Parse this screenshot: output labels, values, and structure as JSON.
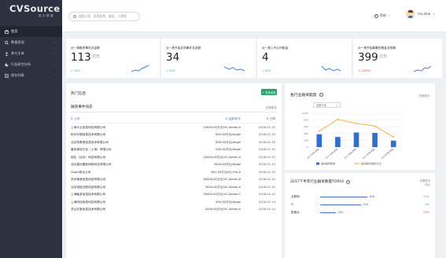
{
  "brand": {
    "logo": "CVSource",
    "sub": "投中数据"
  },
  "sidebar": {
    "items": [
      {
        "label": "首页",
        "active": true,
        "has_chevron": false,
        "icon": "home-icon"
      },
      {
        "label": "数据发现",
        "active": false,
        "has_chevron": true,
        "icon": "search-icon"
      },
      {
        "label": "参与主体",
        "active": false,
        "has_chevron": true,
        "icon": "people-icon"
      },
      {
        "label": "行业研究分析",
        "active": false,
        "has_chevron": true,
        "icon": "chart-icon"
      },
      {
        "label": "保存列表",
        "active": false,
        "has_chevron": true,
        "icon": "list-icon"
      }
    ]
  },
  "topbar": {
    "search_placeholder": "搜索公司、投资机构、基金、人物等",
    "help_label": "帮助",
    "help_chevron": "∨",
    "username": "ms.zhai",
    "user_chevron": "∨"
  },
  "stats": [
    {
      "label": "近一周融资事件总金额",
      "value": "113",
      "unit": "亿元",
      "change": "↓ 16%",
      "negative": false,
      "colors": "#3b7fd9"
    },
    {
      "label": "近一周开始并购事件总金额",
      "value": "34",
      "unit": "",
      "change": "↓ 40%",
      "negative": false
    },
    {
      "label": "近一周上市公司数量",
      "value": "4",
      "unit": "",
      "change": "↓ 60%",
      "negative": false
    },
    {
      "label": "近一周开始募集的基金总规模",
      "value": "399",
      "unit": "亿元",
      "change": "↑ 1229%",
      "negative": true
    }
  ],
  "hot": {
    "title": "热门信息",
    "publish_label": "+ 发布动态",
    "tab": "融资事件动态",
    "more": "查看更多",
    "columns": [
      "公司",
      "金额/轮次",
      "日期"
    ],
    "rows": [
      [
        "上海众云信息科技有限公司",
        "10000.00万元/VC-Series A",
        "2018.01.15"
      ],
      [
        "杭州乐期信息技术有限公司",
        "500.00万元/Angel",
        "2018.01.15"
      ],
      [
        "北京牧青美信息技术有限公司",
        "500.00万元/Angel",
        "2018.01.15"
      ],
      [
        "重庆美地文化（上海）有限公司",
        "200.00万元/Angel",
        "2018.01.15"
      ],
      [
        "和应（北京）科技有限公司",
        "10000.00万元/VC-Series A",
        "2018.01.15"
      ],
      [
        "北京星优耀信网络科技有限公司",
        "2000.00万元/Angel",
        "2018.01.15"
      ],
      [
        "Zoom购买公司",
        "651.00万元/VC-Pre-A",
        "2018.01.15"
      ],
      [
        "苏州美维信息科技有限公司",
        "40000.00万元/VC-Series B",
        "2018.01.15"
      ],
      [
        "北京锐能互联科技有限公司",
        "3000.00万元/VC-Series A",
        "2018.01.15"
      ],
      [
        "上海聚游信息技术有限公司",
        "30000.00万元/VC-Series C",
        "2018.01.15"
      ],
      [
        "上海听知信息科技有限公司",
        "300.00万元/Angel",
        "2018.01.14"
      ],
      [
        "苏云红数信息技术有限公司",
        "2000.00万元/VC-Series A",
        "2018.01.14"
      ]
    ]
  },
  "trend": {
    "title": "各行业融资趋势",
    "help": "?",
    "more": "查看更多",
    "select_label": "全部行业",
    "select_arrow": "∨",
    "legend": [
      "融资事件数量",
      "融资事件金额(亿元)"
    ]
  },
  "chart_data": {
    "type": "bar",
    "categories": [
      "2017年第1季度",
      "2017年第2季度",
      "2017年第3季度",
      "2017年第4季度",
      "2018年第1季度"
    ],
    "ylim": [
      0,
      1000
    ],
    "ytick_labels": [
      "1,000",
      "800",
      "600",
      "400",
      "200",
      "0"
    ],
    "series": [
      {
        "name": "融资事件数量",
        "values": [
          380,
          300,
          430,
          420,
          190
        ]
      },
      {
        "name": "融资事件金额(亿元)",
        "values": [
          470,
          820,
          700,
          620,
          300
        ]
      }
    ],
    "colors": [
      "#2f6fd1",
      "#f5a53a"
    ]
  },
  "top10": {
    "title": "2017下半年行业融资数量TOP10",
    "help": "?",
    "more_line1": "查看更多",
    "more_line2": "同比",
    "rows": [
      {
        "name": "互联网",
        "value": "618",
        "bar": 0.85,
        "pct": "-12%",
        "negative": false
      },
      {
        "name": "IT",
        "value": "534",
        "bar": 0.74,
        "pct": "-3%",
        "negative": false
      },
      {
        "name": "制造业",
        "value": "202",
        "bar": 0.28,
        "pct": "25%",
        "negative": true
      }
    ]
  }
}
